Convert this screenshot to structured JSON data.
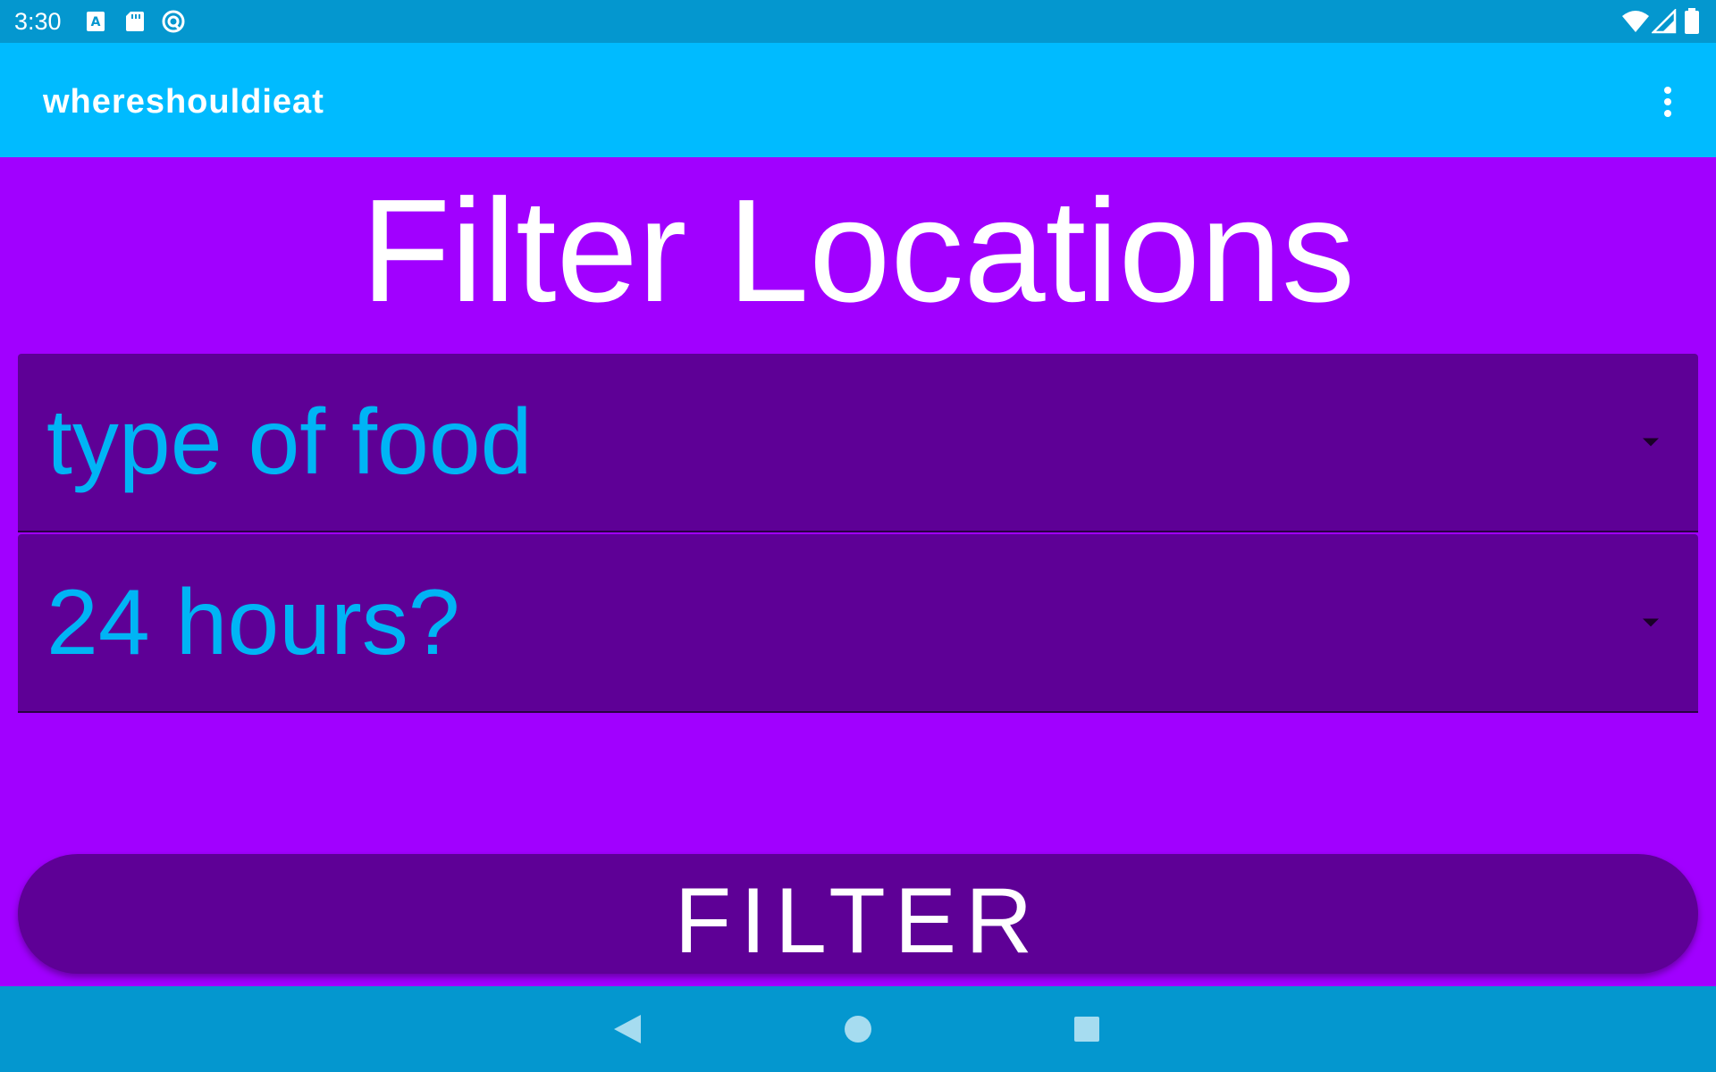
{
  "status_bar": {
    "time": "3:30",
    "left_icons": [
      "a-keyboard-icon",
      "sd-card-icon",
      "no-disturb-icon"
    ],
    "right_icons": [
      "wifi-icon",
      "signal-icon",
      "battery-icon"
    ]
  },
  "app_bar": {
    "title": "whereshouldieat",
    "menu_icon": "more-vert-icon"
  },
  "main": {
    "heading": "Filter Locations",
    "spinners": [
      {
        "label": "type of food",
        "icon": "dropdown-arrow-icon"
      },
      {
        "label": "24 hours?",
        "icon": "dropdown-arrow-icon"
      }
    ],
    "filter_button_label": "FILTER"
  },
  "nav_bar": {
    "buttons": [
      "back-icon",
      "home-icon",
      "recents-icon"
    ]
  },
  "colors": {
    "status_bar": "#0497cf",
    "app_bar": "#00bbff",
    "background": "#a100ff",
    "spinner_bg": "#5e0096",
    "spinner_text": "#00b4f5",
    "button_bg": "#5e0096",
    "text_white": "#ffffff"
  }
}
